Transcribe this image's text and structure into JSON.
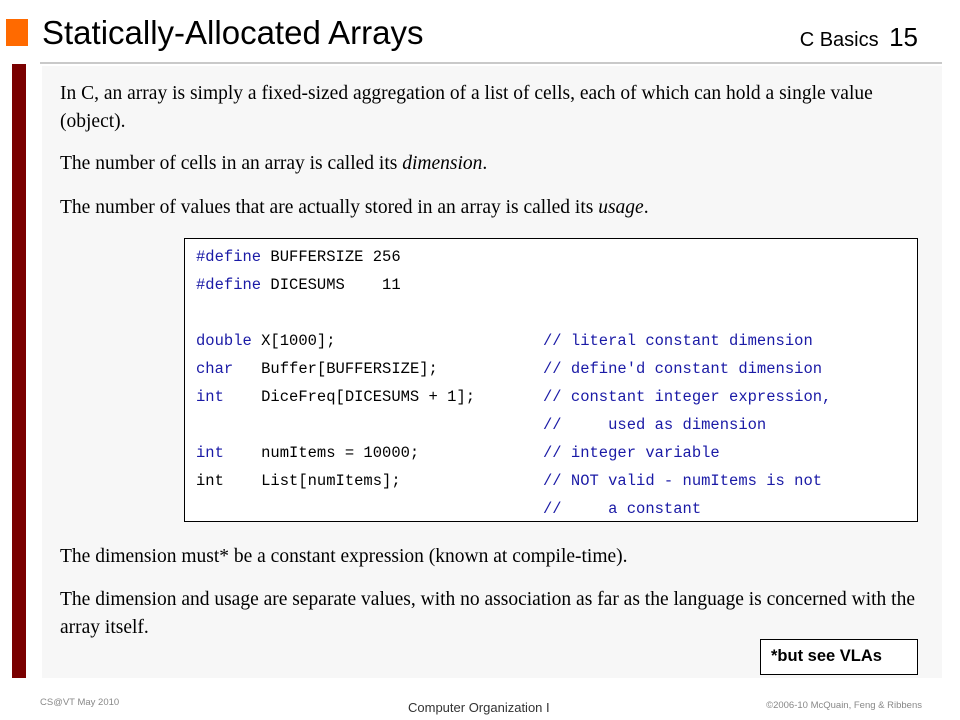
{
  "slide": {
    "title": "Statically-Allocated Arrays",
    "course": "C Basics",
    "number": "15",
    "colors": {
      "accent_orange": "#ff6a00",
      "left_bar": "#7a0000",
      "code_keyword": "#1a1aa6"
    }
  },
  "body": {
    "p1": "In C, an array is simply a fixed-sized aggregation of a list of cells, each of which can hold a single value (object).",
    "p2_before": "The number of cells in an array is called its ",
    "p2_term": "dimension",
    "p2_after": ".",
    "p3_before": "The number of values that are actually stored in an array is called its ",
    "p3_term": "usage",
    "p3_after": ".",
    "p4": "The dimension must* be a constant expression (known at compile-time).",
    "p5": "The dimension and usage are separate values, with no association as far as the language is concerned with the array itself."
  },
  "code": {
    "lines": [
      {
        "kw": "#define",
        "rest": " BUFFERSIZE 256",
        "comment": ""
      },
      {
        "kw": "#define",
        "rest": " DICESUMS    11",
        "comment": ""
      },
      {
        "kw": "",
        "rest": "",
        "comment": ""
      },
      {
        "kw": "double",
        "rest": " X[1000];",
        "comment": "// literal constant dimension"
      },
      {
        "kw": "char",
        "rest": "   Buffer[BUFFERSIZE];",
        "comment": "// define'd constant dimension"
      },
      {
        "kw": "int",
        "rest": "    DiceFreq[DICESUMS + 1];",
        "comment": "// constant integer expression,"
      },
      {
        "kw": "",
        "rest": "",
        "comment": "//     used as dimension"
      },
      {
        "kw": "int",
        "rest": "    numItems = 10000;",
        "comment": "// integer variable"
      },
      {
        "kw": "",
        "rest": "int    List[numItems];",
        "comment": "// NOT valid - numItems is not"
      },
      {
        "kw": "",
        "rest": "",
        "comment": "//     a constant"
      }
    ]
  },
  "note": "*but see VLAs",
  "footer": {
    "left": "CS@VT May 2010",
    "center": "Computer Organization I",
    "right": "©2006-10  McQuain, Feng & Ribbens"
  }
}
